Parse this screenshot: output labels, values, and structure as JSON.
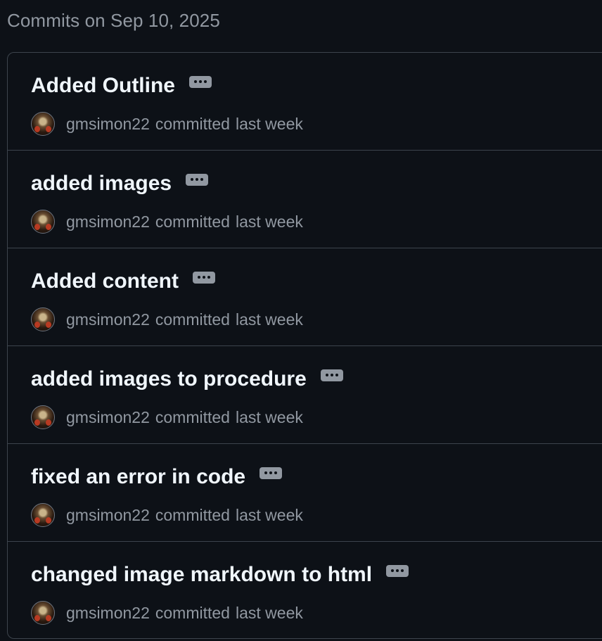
{
  "heading": "Commits on Sep 10, 2025",
  "commits": [
    {
      "title": "Added Outline",
      "author": "gmsimon22",
      "verb": "committed",
      "when": "last week"
    },
    {
      "title": "added images",
      "author": "gmsimon22",
      "verb": "committed",
      "when": "last week"
    },
    {
      "title": "Added content",
      "author": "gmsimon22",
      "verb": "committed",
      "when": "last week"
    },
    {
      "title": "added images to procedure",
      "author": "gmsimon22",
      "verb": "committed",
      "when": "last week"
    },
    {
      "title": "fixed an error in code",
      "author": "gmsimon22",
      "verb": "committed",
      "when": "last week"
    },
    {
      "title": "changed image markdown to html",
      "author": "gmsimon22",
      "verb": "committed",
      "when": "last week"
    }
  ],
  "icons": {
    "avatar": "user-avatar",
    "expand": "ellipsis-icon"
  },
  "colors": {
    "background": "#0d1117",
    "border": "#3d444d",
    "title": "#f0f6fc",
    "muted": "#9198a1"
  }
}
